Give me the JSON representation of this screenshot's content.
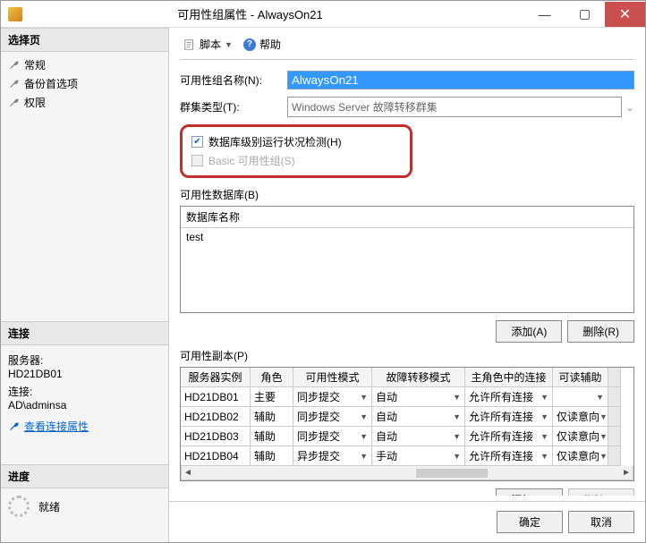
{
  "titlebar": {
    "text": "可用性组属性 - AlwaysOn21"
  },
  "sidebar": {
    "select_header": "选择页",
    "items": [
      {
        "label": "常规"
      },
      {
        "label": "备份首选项"
      },
      {
        "label": "权限"
      }
    ],
    "conn_header": "连接",
    "server_label": "服务器:",
    "server_value": "HD21DB01",
    "conn_label": "连接:",
    "conn_value": "AD\\adminsa",
    "view_props": "查看连接属性",
    "progress_header": "进度",
    "ready": "就绪"
  },
  "toolbar": {
    "script": "脚本",
    "help": "帮助"
  },
  "form": {
    "name_label": "可用性组名称(N):",
    "name_value": "AlwaysOn21",
    "cluster_label": "群集类型(T):",
    "cluster_value": "Windows Server 故障转移群集",
    "chk_db_health": "数据库级别运行状况检测(H)",
    "chk_basic": "Basic 可用性组(S)"
  },
  "db": {
    "label": "可用性数据库(B)",
    "header": "数据库名称",
    "rows": [
      "test"
    ],
    "add": "添加(A)",
    "remove": "删除(R)"
  },
  "replica": {
    "label": "可用性副本(P)",
    "headers": [
      "服务器实例",
      "角色",
      "可用性模式",
      "故障转移模式",
      "主角色中的连接",
      "可读辅助"
    ],
    "rows": [
      {
        "server": "HD21DB01",
        "role": "主要",
        "mode": "同步提交",
        "failover": "自动",
        "primary_conn": "允许所有连接",
        "readable": ""
      },
      {
        "server": "HD21DB02",
        "role": "辅助",
        "mode": "同步提交",
        "failover": "自动",
        "primary_conn": "允许所有连接",
        "readable": "仅读意向"
      },
      {
        "server": "HD21DB03",
        "role": "辅助",
        "mode": "同步提交",
        "failover": "自动",
        "primary_conn": "允许所有连接",
        "readable": "仅读意向"
      },
      {
        "server": "HD21DB04",
        "role": "辅助",
        "mode": "异步提交",
        "failover": "手动",
        "primary_conn": "允许所有连接",
        "readable": "仅读意向"
      }
    ],
    "add": "添加(D)",
    "remove": "删除(E)"
  },
  "dialog": {
    "ok": "确定",
    "cancel": "取消"
  }
}
